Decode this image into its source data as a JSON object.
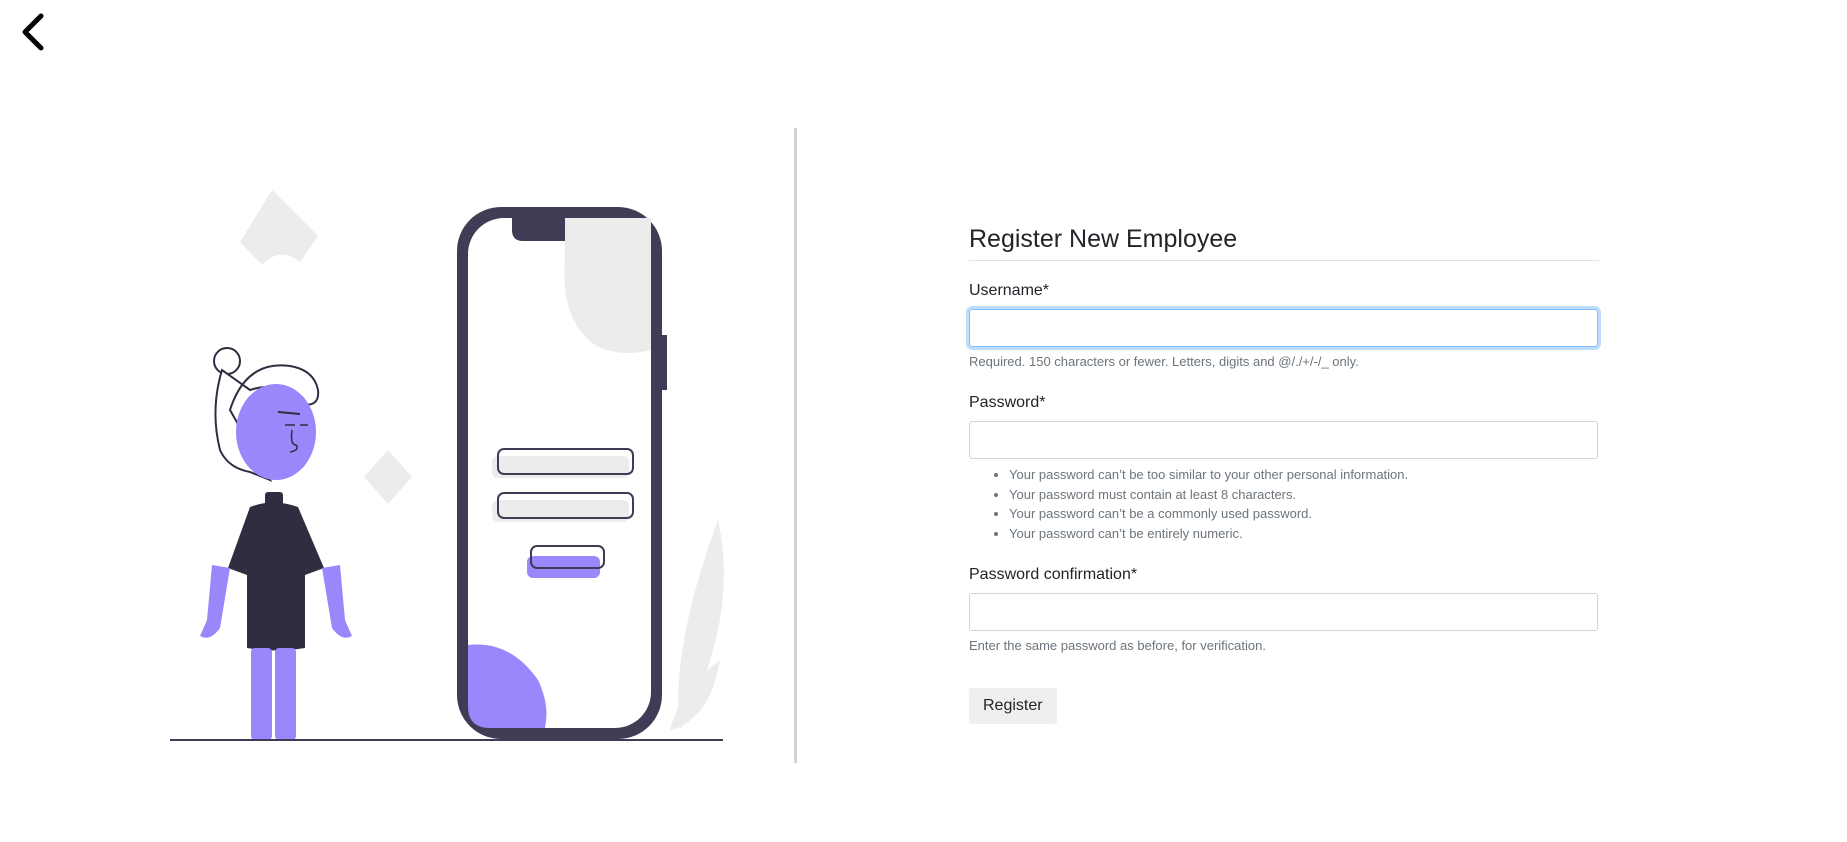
{
  "nav": {
    "back_icon": "chevron-left-icon"
  },
  "form": {
    "title": "Register New Employee",
    "username": {
      "label": "Username*",
      "value": "",
      "help": "Required. 150 characters or fewer. Letters, digits and @/./+/-/_ only."
    },
    "password": {
      "label": "Password*",
      "value": "",
      "help_items": [
        "Your password can’t be too similar to your other personal information.",
        "Your password must contain at least 8 characters.",
        "Your password can’t be a commonly used password.",
        "Your password can’t be entirely numeric."
      ]
    },
    "password_confirmation": {
      "label": "Password confirmation*",
      "value": "",
      "help": "Enter the same password as before, for verification."
    },
    "submit_label": "Register"
  },
  "colors": {
    "accent": "#9b87fc",
    "dark": "#3f3d56",
    "focus": "#80bdff"
  }
}
